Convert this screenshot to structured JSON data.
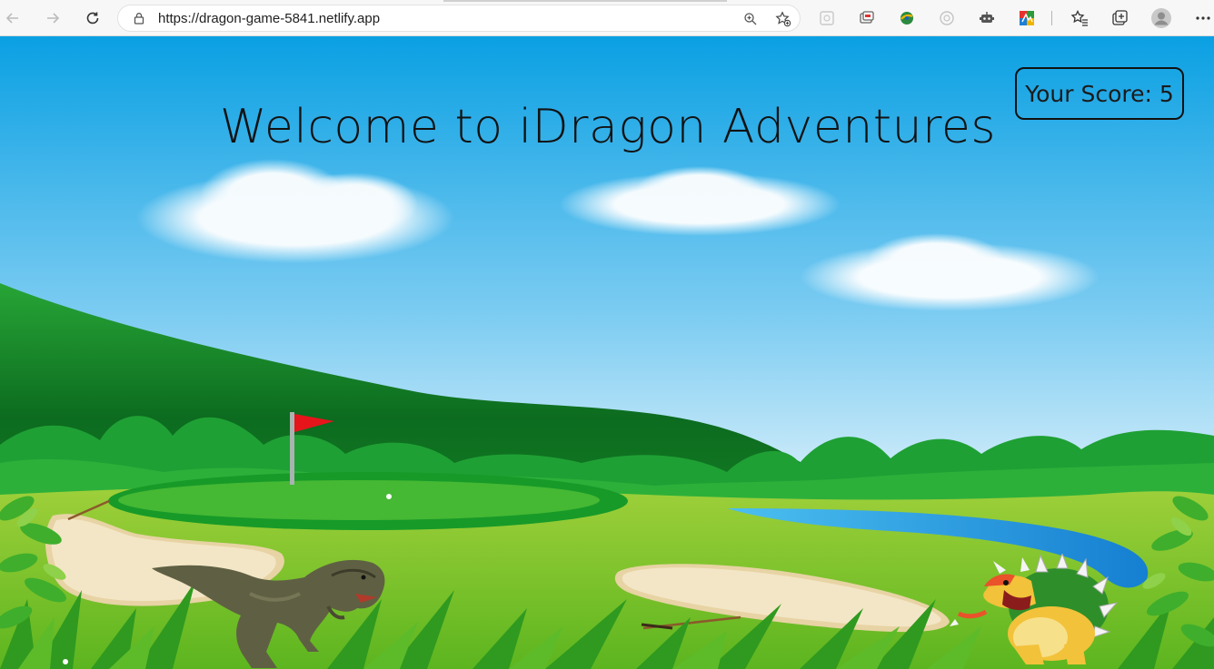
{
  "browser": {
    "url": "https://dragon-game-5841.netlify.app",
    "icons": {
      "back": "arrow-left-icon",
      "forward": "arrow-right-icon",
      "reload": "reload-icon",
      "zoom": "zoom-in-icon",
      "favorite_add": "star-add-icon",
      "extensions": [
        "extension-icon-1",
        "extension-icon-2",
        "extension-icon-3",
        "extension-icon-4",
        "extension-icon-5",
        "extension-icon-6"
      ],
      "favorites": "favorites-icon",
      "collections": "collections-icon",
      "profile": "profile-icon",
      "menu": "more-icon"
    }
  },
  "game": {
    "title": "Welcome to iDragon Adventures",
    "score_text": "Your Score: 5",
    "colors": {
      "sky_top": "#0aa0e3",
      "sky_bottom": "#dff2fb",
      "hill_dark": "#0c6b1f",
      "grass": "#7cc427",
      "putting_green": "#45b834",
      "flag": "#e6141b",
      "water": "#1f9de2",
      "sand": "#f1e2c0"
    },
    "sprites": [
      "dinosaur",
      "dragon"
    ]
  }
}
